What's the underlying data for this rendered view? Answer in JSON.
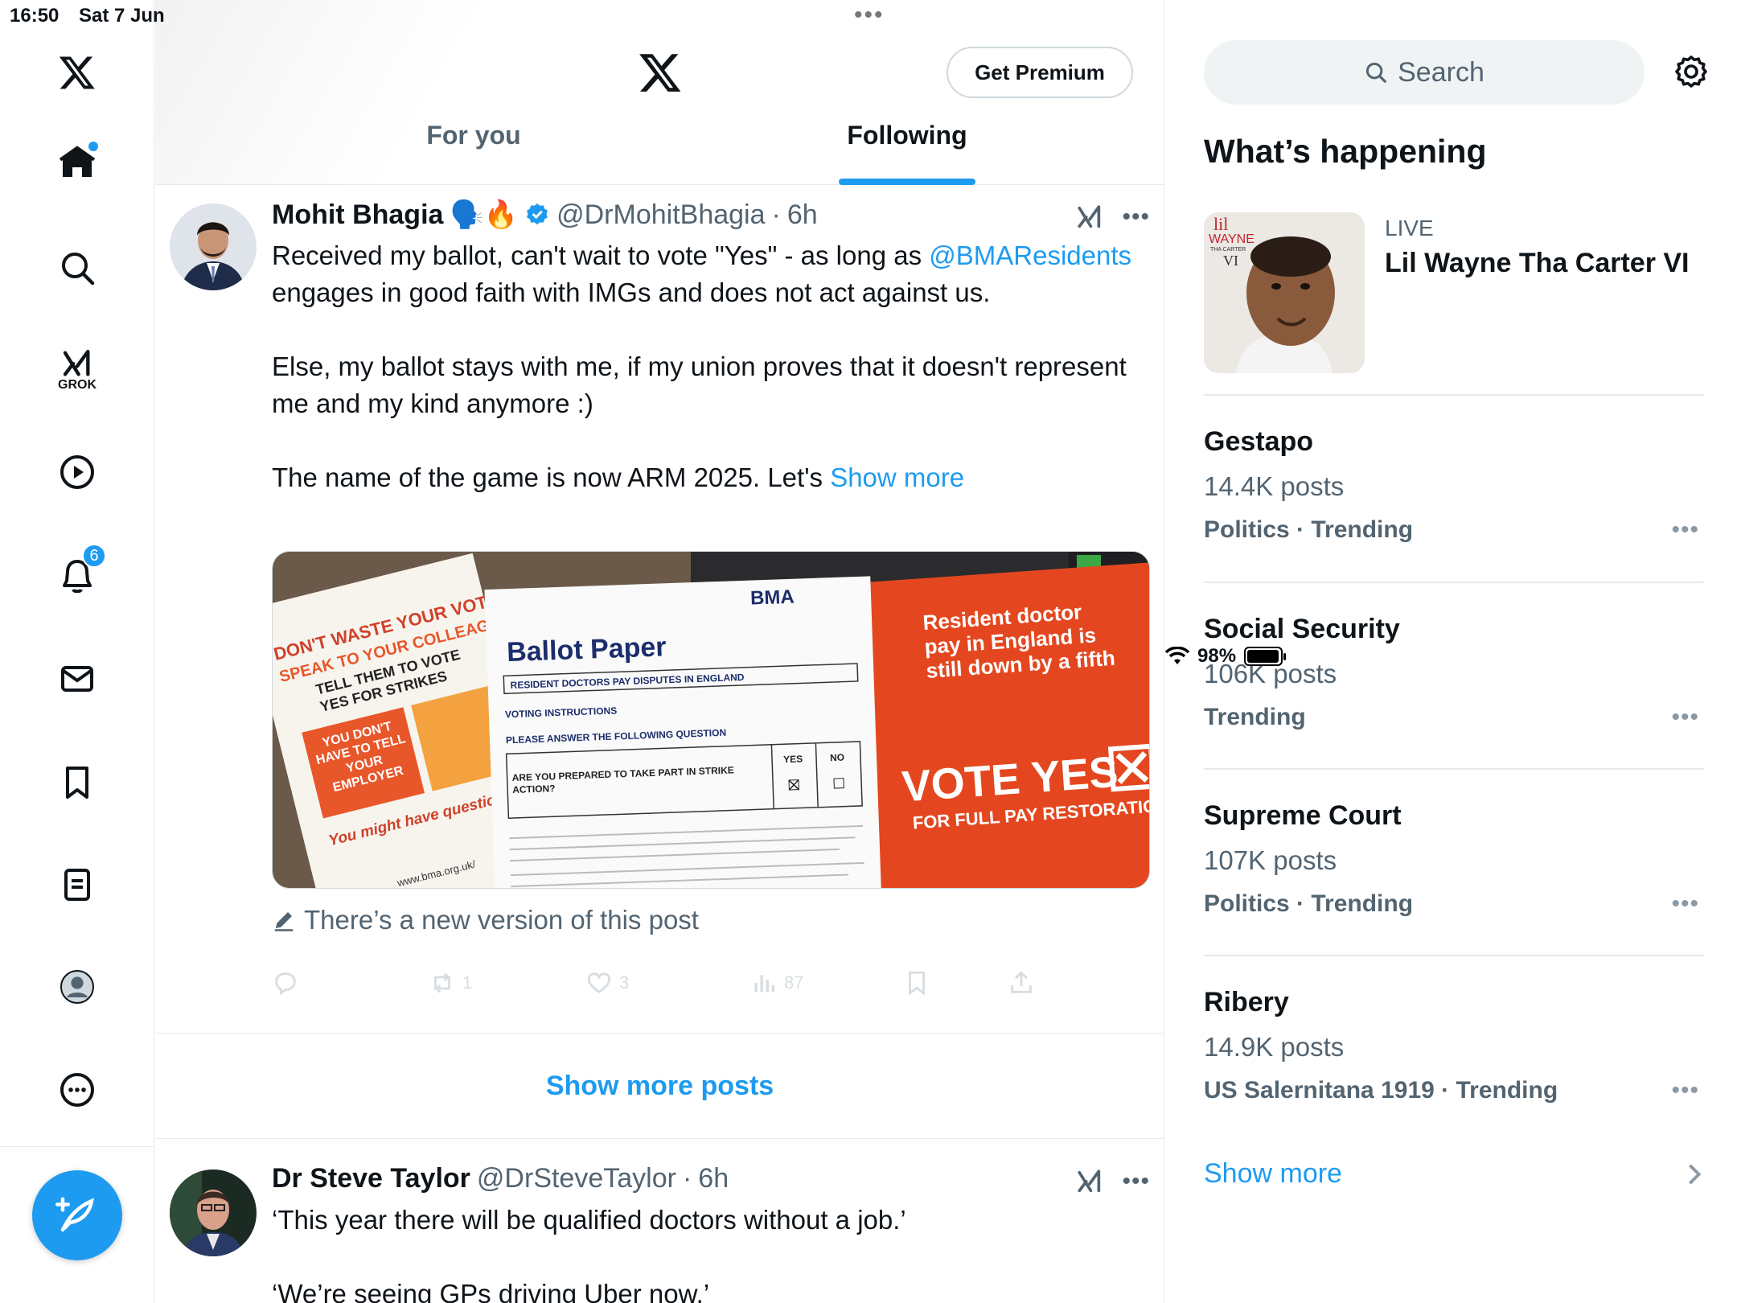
{
  "status_bar": {
    "time": "16:50",
    "date": "Sat 7 Jun",
    "battery": "98%",
    "battery_level": 0.98
  },
  "nav": {
    "grok_label": "GROK",
    "notifications_count": "6"
  },
  "header": {
    "premium_label": "Get Premium",
    "tabs": [
      {
        "label": "For you",
        "active": false
      },
      {
        "label": "Following",
        "active": true
      }
    ]
  },
  "post1": {
    "name": "Mohit Bhagia",
    "emojis": "🗣️🔥",
    "handle": "@DrMohitBhagia",
    "separator": "·",
    "time": "6h",
    "text_line1a": "Received my ballot, can't wait to vote \"Yes\" - as long as",
    "mention": "@BMAResidents",
    "text_line2b": " engages in good faith with IMGs and does not act against us.",
    "para2": "Else, my ballot stays with me, if my union proves that it doesn't represent me and my kind anymore :)",
    "para3": "The name of the game is now ARM 2025. Let's ",
    "show_more": "Show more",
    "edit_note": "There’s a new version of this post",
    "actions": {
      "replies": "",
      "reposts": "1",
      "likes": "3",
      "views": "87"
    },
    "media": {
      "flyer_lines": [
        "DON'T WASTE YOUR VOTE",
        "SPEAK TO YOUR COLLEAGUES",
        "TELL THEM TO VOTE",
        "YES FOR STRIKES"
      ],
      "flyer_box": "YOU DON'T HAVE TO TELL YOUR EMPLOYER",
      "flyer_q": "You might have questions",
      "flyer_site": "www.bma.org.uk/",
      "bma": "BMA",
      "ballot_title": "Ballot Paper",
      "ballot_dispute": "RESIDENT DOCTORS PAY DISPUTES IN ENGLAND",
      "voting_instructions": "VOTING INSTRUCTIONS",
      "please_answer": "PLEASE ANSWER THE FOLLOWING QUESTION",
      "question": "ARE YOU PREPARED TO TAKE PART IN STRIKE ACTION?",
      "yes": "YES",
      "no": "NO",
      "red_text": "Resident doctor pay in England is still down by a fifth",
      "vote_yes": "VOTE YES",
      "full_pay": "FOR FULL PAY RESTORATION"
    }
  },
  "show_more_posts": "Show more posts",
  "post2": {
    "name": "Dr Steve Taylor",
    "handle": "@DrSteveTaylor",
    "separator": "·",
    "time": "6h",
    "line1": "‘This year there will be qualified doctors without a job.’",
    "line2": "‘We’re seeing GPs driving Uber now.’"
  },
  "sidebar": {
    "search_placeholder": "Search",
    "heading": "What’s happening",
    "live": {
      "label": "LIVE",
      "title": "Lil Wayne Tha Carter VI",
      "album_text": {
        "lil": "lil",
        "wayne": "WAYNE",
        "carter": "THA CARTER",
        "vi": "VI"
      }
    },
    "trends": [
      {
        "title": "Gestapo",
        "count": "14.4K posts",
        "meta": "Politics · Trending"
      },
      {
        "title": "Social Security",
        "count": "106K posts",
        "meta": "Trending"
      },
      {
        "title": "Supreme Court",
        "count": "107K posts",
        "meta": "Politics · Trending"
      },
      {
        "title": "Ribery",
        "count": "14.9K posts",
        "meta": "US Salernitana 1919 · Trending"
      }
    ],
    "show_more": "Show more"
  },
  "colors": {
    "accent": "#1d9bf0",
    "text": "#0f1419",
    "secondary": "#536471",
    "flyer_orange": "#e8572a",
    "poster_red": "#e4471f"
  }
}
